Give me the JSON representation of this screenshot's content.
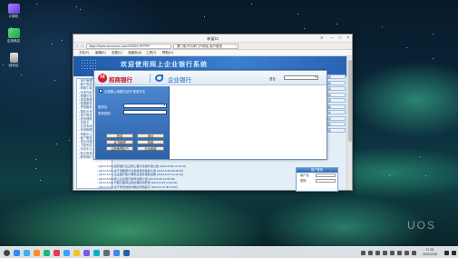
{
  "desktop": {
    "icons": [
      {
        "label": "计算机",
        "icon": "computer-icon"
      },
      {
        "label": "应用商店",
        "icon": "app-store-icon"
      },
      {
        "label": "回收站",
        "icon": "trash-icon"
      }
    ],
    "watermark": "UOS"
  },
  "window": {
    "title": "新窗口",
    "controls": [
      "menu",
      "minimize",
      "maximize",
      "close"
    ]
  },
  "browser": {
    "url": "https://www.xxxxxxxxx.com/SSSSS.PPPPP",
    "tab_label": "厦门电子口岸门户网站 用户登录",
    "menu": [
      "文件(F)",
      "编辑(E)",
      "查看(V)",
      "收藏夹(A)",
      "工具(T)",
      "帮助(H)"
    ]
  },
  "page": {
    "banner_text": "欢迎使用网上企业银行系统",
    "left_nav": [
      "用户管理",
      "账户查询",
      "转账汇款",
      "代发代扣",
      "票据业务",
      "现金管理",
      "集团服务",
      "贸易融资",
      "国际业务",
      "电子商务",
      "投资理财",
      "信用卡",
      "业务查询",
      "系统管理",
      "帮助中心",
      "客户服务",
      "常见问题",
      "下载专区",
      "安全中心",
      "网点查询",
      "联系我们"
    ],
    "main_list": [
      "[2014-5-05] 招商银行企业网上银行系统升级公告  (2014-5-05 10:11:23)",
      "[2014-5-06] 关于调整部分业务收费标准的公告  (2014-5-06 09:30:00)",
      "[2014-5-07] 企业银行客户端安全控件更新说明  (2014-5-07 14:22:10)",
      "[2014-5-08] 网上企业银行新增功能介绍  (2014-5-08 16:05:45)",
      "[2014-5-09] 节假日期间业务办理时间安排  (2014-5-09 11:40:02)",
      "[2014-5-10] 关于防范电信诈骗的风险提示  (2014-5-10 08:15:30)"
    ],
    "right_menu": [
      "新闻",
      "公告",
      "产品",
      "服务",
      "下载",
      "帮助",
      "安全",
      "网点",
      "联系",
      "更多"
    ],
    "user_box": {
      "title": "用户登录",
      "fields": [
        "用户名:",
        "密码:"
      ]
    }
  },
  "dialog": {
    "bank_name": "招商银行",
    "product_name": "企业银行",
    "language_label": "语言:",
    "login": {
      "title": "已装载公用数字证书    登录方式",
      "fields": [
        {
          "label": "登录名:",
          "kind": "dropdown"
        },
        {
          "label": "登录密码:",
          "kind": "text"
        }
      ],
      "buttons": [
        "登录",
        "退出",
        "证书管理",
        "帮助",
        "注册管理用户",
        "在线客服"
      ]
    }
  },
  "taskbar": {
    "clock_time": "17:25",
    "clock_date": "2021/2/26"
  }
}
